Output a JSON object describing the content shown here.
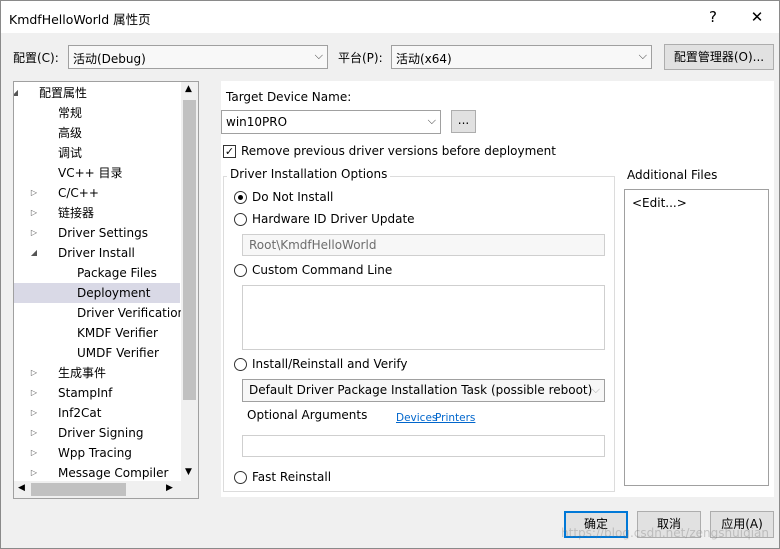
{
  "window": {
    "title": "KmdfHelloWorld 属性页",
    "help_label": "?",
    "close_label": "✕"
  },
  "toolbar": {
    "config_label": "配置(C):",
    "config_value": "活动(Debug)",
    "platform_label": "平台(P):",
    "platform_value": "活动(x64)",
    "config_manager_label": "配置管理器(O)..."
  },
  "tree": {
    "items": [
      {
        "label": "配置属性",
        "expander": "◢"
      },
      {
        "label": "常规",
        "expander": ""
      },
      {
        "label": "高级",
        "expander": ""
      },
      {
        "label": "调试",
        "expander": ""
      },
      {
        "label": "VC++ 目录",
        "expander": ""
      },
      {
        "label": "C/C++",
        "expander": "▷"
      },
      {
        "label": "链接器",
        "expander": "▷"
      },
      {
        "label": "Driver Settings",
        "expander": "▷"
      },
      {
        "label": "Driver Install",
        "expander": "◢"
      },
      {
        "label": "Package Files",
        "expander": ""
      },
      {
        "label": "Deployment",
        "expander": ""
      },
      {
        "label": "Driver Verification",
        "expander": ""
      },
      {
        "label": "KMDF Verifier",
        "expander": ""
      },
      {
        "label": "UMDF Verifier",
        "expander": ""
      },
      {
        "label": "生成事件",
        "expander": "▷"
      },
      {
        "label": "StampInf",
        "expander": "▷"
      },
      {
        "label": "Inf2Cat",
        "expander": "▷"
      },
      {
        "label": "Driver Signing",
        "expander": "▷"
      },
      {
        "label": "Wpp Tracing",
        "expander": "▷"
      },
      {
        "label": "Message Compiler",
        "expander": "▷"
      }
    ],
    "selected": "Deployment"
  },
  "deployment": {
    "target_device_label": "Target Device Name:",
    "target_device_value": "win10PRO",
    "browse_label": "...",
    "remove_previous_label": "Remove previous driver versions before deployment",
    "remove_previous_checked": true,
    "options_title": "Driver Installation Options",
    "opt_do_not_install": "Do Not Install",
    "opt_hardware_id": "Hardware ID Driver Update",
    "hardware_id_value": "Root\\KmdfHelloWorld",
    "opt_custom_command": "Custom Command Line",
    "opt_install_reinstall": "Install/Reinstall and Verify",
    "install_task_value": "Default Driver Package Installation Task (possible reboot)",
    "optional_args_label": "Optional Arguments",
    "devices_link": "Devices",
    "printers_link": "Printers",
    "opt_fast_reinstall": "Fast Reinstall",
    "selected_option": "Do Not Install"
  },
  "additional_files": {
    "title": "Additional Files",
    "edit_label": "<Edit...>"
  },
  "footer": {
    "ok_label": "确定",
    "cancel_label": "取消",
    "apply_label": "应用(A)"
  },
  "watermark": "https://blog.csdn.net/zengshuiqian",
  "colors": {
    "accent": "#0078d7",
    "selection": "#d9d9e6",
    "link": "#0066cc"
  }
}
